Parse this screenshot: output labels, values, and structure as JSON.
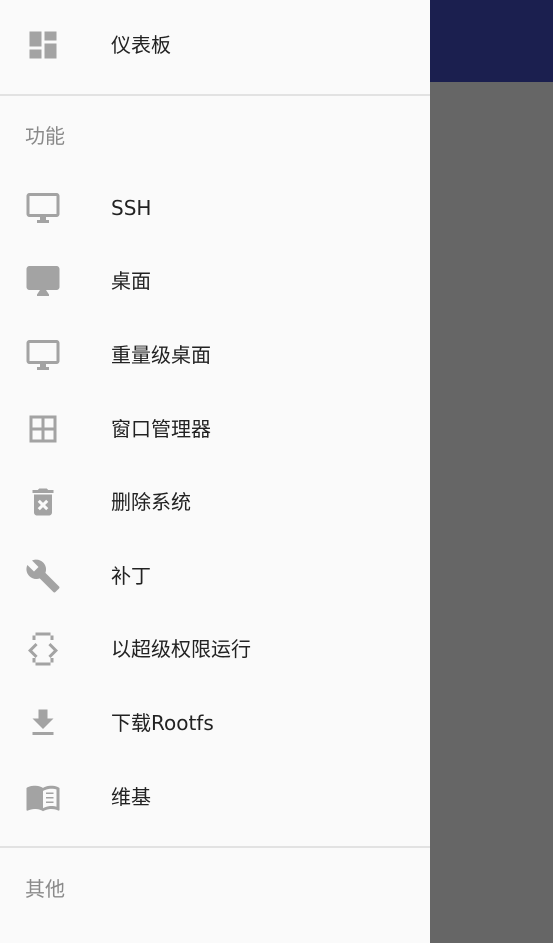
{
  "drawer": {
    "top_item": {
      "label": "仪表板",
      "icon": "dashboard-icon"
    },
    "sections": [
      {
        "header": "功能",
        "items": [
          {
            "label": "SSH",
            "icon": "monitor-icon"
          },
          {
            "label": "桌面",
            "icon": "desktop-icon"
          },
          {
            "label": "重量级桌面",
            "icon": "desktop-outline-icon"
          },
          {
            "label": "窗口管理器",
            "icon": "grid-icon"
          },
          {
            "label": "删除系统",
            "icon": "trash-icon"
          },
          {
            "label": "补丁",
            "icon": "wrench-icon"
          },
          {
            "label": "以超级权限运行",
            "icon": "code-brackets-icon"
          },
          {
            "label": "下载Rootfs",
            "icon": "download-icon"
          },
          {
            "label": "维基",
            "icon": "book-icon"
          }
        ]
      },
      {
        "header": "其他",
        "items": []
      }
    ]
  },
  "colors": {
    "drawer_bg": "#fafafa",
    "icon": "#a3a3a3",
    "appbar": "#1b1f4f",
    "scrim": "#666666"
  }
}
